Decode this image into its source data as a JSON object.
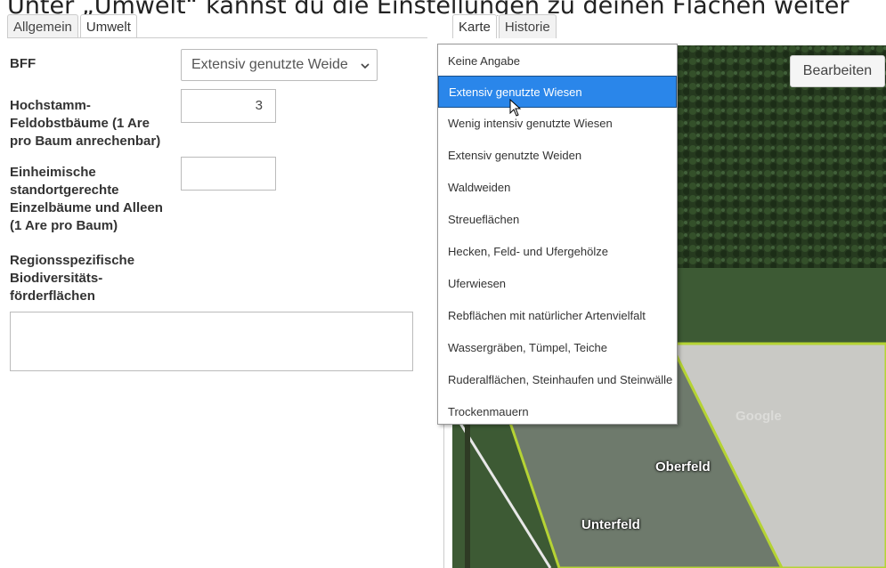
{
  "caption": "Unter „Umwelt“ kannst du die Einstellungen zu deinen Flächen weiter",
  "left_tabs": [
    "Allgemein",
    "Umwelt"
  ],
  "right_tabs": [
    "Karte",
    "Historie"
  ],
  "form": {
    "bff_label": "BFF",
    "bff_value": "Extensiv genutzte Weide",
    "hochstamm_label": "Hochstamm-\nFeldobstbäume (1 Are\npro Baum anrechenbar)",
    "hochstamm_value": "3",
    "einheimische_label": "Einheimische\nstandortgerechte\nEinzelbäume und Alleen\n(1 Are pro Baum)",
    "einheimische_value": "",
    "regions_label": "Regionsspezifische\nBiodiversitäts-\nförderflächen",
    "regions_value": ""
  },
  "map": {
    "edit_button": "Bearbeiten",
    "labels": [
      "Oberfeld",
      "Unterfeld",
      "Google"
    ]
  },
  "dropdown": {
    "selected_index": 1,
    "options": [
      "Keine Angabe",
      "Extensiv genutzte Wiesen",
      "Wenig intensiv genutzte Wiesen",
      "Extensiv genutzte Weiden",
      "Waldweiden",
      "Streueflächen",
      "Hecken, Feld- und Ufergehölze",
      "Uferwiesen",
      "Rebflächen mit natürlicher Artenvielfalt",
      "Wassergräben, Tümpel, Teiche",
      "Ruderalflächen, Steinhaufen und Steinwälle",
      "Trockenmauern"
    ]
  },
  "colors": {
    "selected": "#2a86ea",
    "field_outline": "#b5d334"
  }
}
